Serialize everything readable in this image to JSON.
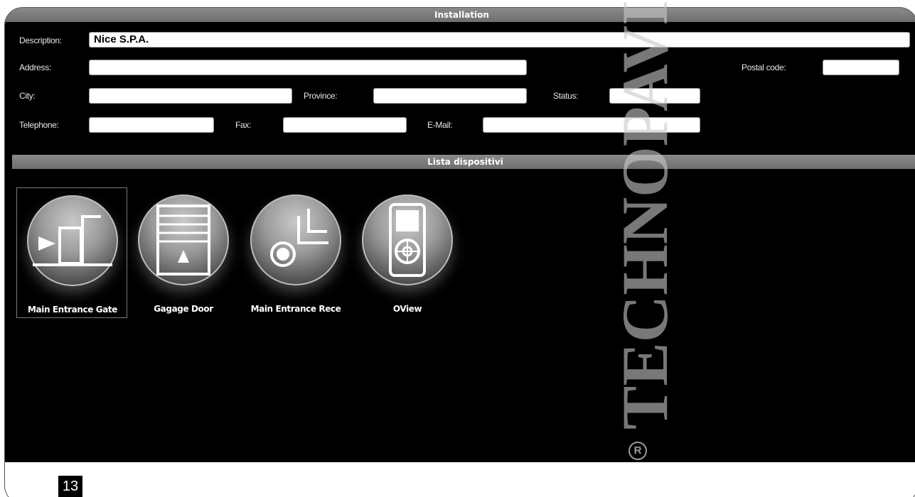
{
  "window": {
    "title": "Installation"
  },
  "form": {
    "description_label": "Description:",
    "description_value": "Nice S.P.A.",
    "address_label": "Address:",
    "address_value": "",
    "postal_label": "Postal code:",
    "postal_value": "",
    "city_label": "City:",
    "city_value": "",
    "province_label": "Province:",
    "province_value": "",
    "status_label": "Status:",
    "status_value": "",
    "telephone_label": "Telephone:",
    "telephone_value": "",
    "fax_label": "Fax:",
    "fax_value": "",
    "email_label": "E-Mail:",
    "email_value": ""
  },
  "devices": {
    "title": "Lista dispositivi",
    "items": [
      {
        "name": "Main Entrance Gate",
        "icon": "gate-icon",
        "selected": true
      },
      {
        "name": "Gagage Door",
        "icon": "garage-door-icon",
        "selected": false
      },
      {
        "name": "Main Entrance Rece",
        "icon": "receiver-icon",
        "selected": false
      },
      {
        "name": "OView",
        "icon": "oview-remote-icon",
        "selected": false
      }
    ]
  },
  "watermark": {
    "text": "TECHNOPAVI",
    "reg": "R"
  },
  "page": {
    "number": "13"
  }
}
